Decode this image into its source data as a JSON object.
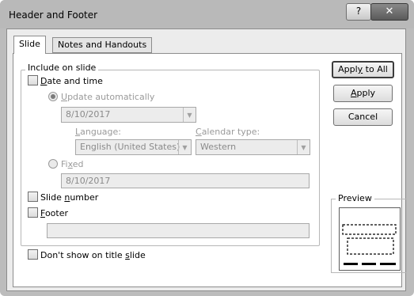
{
  "window": {
    "title": "Header and Footer",
    "help_glyph": "?",
    "close_glyph": "✕"
  },
  "tabs": [
    {
      "label": "Slide",
      "active": true
    },
    {
      "label": "Notes and Handouts",
      "active": false
    }
  ],
  "include_on_slide": {
    "legend": "Include on slide",
    "date_and_time": {
      "label_pre": "",
      "label_key": "D",
      "label_post": "ate and time",
      "checked": false,
      "update_automatically": {
        "label_pre": "",
        "label_key": "U",
        "label_post": "pdate automatically",
        "selected": true
      },
      "auto_date_value": "8/10/2017",
      "language": {
        "label_pre": "",
        "label_key": "L",
        "label_post": "anguage:",
        "value": "English (United States)"
      },
      "calendar_type": {
        "label_pre": "",
        "label_key": "C",
        "label_post": "alendar type:",
        "value": "Western"
      },
      "fixed": {
        "label_pre": "Fi",
        "label_key": "x",
        "label_post": "ed",
        "selected": false,
        "value": "8/10/2017"
      }
    },
    "slide_number": {
      "label_pre": "Slide ",
      "label_key": "n",
      "label_post": "umber",
      "checked": false
    },
    "footer": {
      "label_pre": "",
      "label_key": "F",
      "label_post": "ooter",
      "checked": false,
      "value": ""
    }
  },
  "dont_show_on_title": {
    "label_pre": "Don't show on title ",
    "label_key": "s",
    "label_post": "lide",
    "checked": false
  },
  "buttons": {
    "apply_all": {
      "label_pre": "Appl",
      "label_key": "y",
      "label_post": " to All"
    },
    "apply": {
      "label_pre": "",
      "label_key": "A",
      "label_post": "pply"
    },
    "cancel": {
      "label": "Cancel"
    }
  },
  "preview": {
    "legend": "Preview"
  },
  "colors": {
    "titlebar": "#b9b9b9",
    "dialog_bg": "#ececec",
    "panel_bg": "#ffffff"
  }
}
